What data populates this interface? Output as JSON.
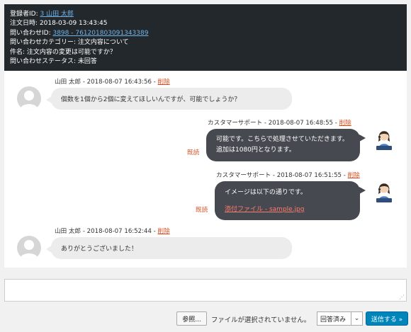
{
  "inquiry": {
    "registrant_label": "登録者ID: ",
    "registrant_link": "3 山田 太郎",
    "order_date": "注文日時: 2018-03-09 13:43:45",
    "inquiry_id_label": "問い合わせID: ",
    "inquiry_id_link": "3898 - 761201803091343389",
    "category": "問い合わせカテゴリー: 注文内容について",
    "subject": "件名: 注文内容の変更は可能ですか？",
    "status": "問い合わせステータス: 未回答"
  },
  "messages": [
    {
      "author_meta": "山田 太郎 - 2018-08-07 16:43:56 - ",
      "delete_label": "削除",
      "body": "個数を1個から2個に変えてほしいんですが、可能でしょうか？"
    },
    {
      "author_meta": "カスタマーサポート - 2018-08-07 16:48:55 - ",
      "delete_label": "削除",
      "read_label": "既読",
      "line1": "可能です。こちらで処理させていただきます。",
      "line2": "追加は1080円となります。"
    },
    {
      "author_meta": "カスタマーサポート - 2018-08-07 16:51:55 - ",
      "delete_label": "削除",
      "read_label": "既読",
      "line1": "イメージは以下の通りです。",
      "attachment": "添付ファイル - sample.jpg"
    },
    {
      "author_meta": "山田 太郎 - 2018-08-07 16:52:44 - ",
      "delete_label": "削除",
      "body": "ありがとうございました！"
    }
  ],
  "composer": {
    "browse_label": "参照...",
    "file_status": "ファイルが選択されていません。",
    "status_value": "回答済み",
    "send_label": "送信する »"
  },
  "icons": {
    "user_avatar": "user-silhouette-icon",
    "staff_avatar": "support-agent-icon",
    "chevron": "chevron-down-icon"
  },
  "colors": {
    "header_bg": "#23282d",
    "link": "#6fb3e8",
    "delete": "#d54e21",
    "staff_bubble": "#464a50",
    "user_bubble": "#ececec",
    "send_button": "#0085ba"
  }
}
